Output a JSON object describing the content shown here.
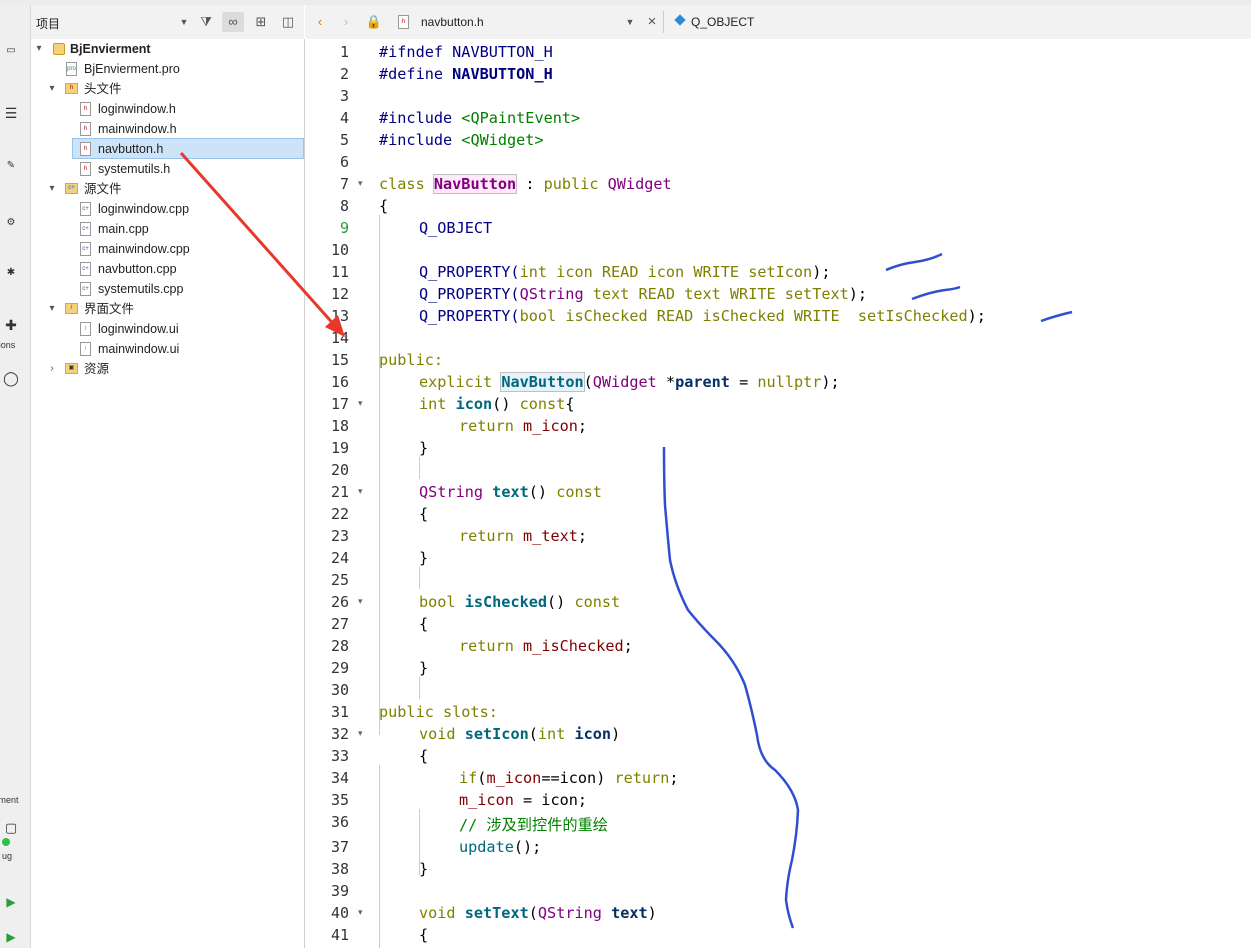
{
  "project_panel": {
    "title": "项目",
    "tree": [
      {
        "label": "BjEnvierment",
        "kind": "project"
      },
      {
        "label": "BjEnvierment.pro",
        "kind": "pro"
      },
      {
        "label": "头文件",
        "kind": "folder-h"
      },
      {
        "label": "loginwindow.h",
        "kind": "h"
      },
      {
        "label": "mainwindow.h",
        "kind": "h"
      },
      {
        "label": "navbutton.h",
        "kind": "h",
        "selected": true
      },
      {
        "label": "systemutils.h",
        "kind": "h"
      },
      {
        "label": "源文件",
        "kind": "folder-cpp"
      },
      {
        "label": "loginwindow.cpp",
        "kind": "cpp"
      },
      {
        "label": "main.cpp",
        "kind": "cpp"
      },
      {
        "label": "mainwindow.cpp",
        "kind": "cpp"
      },
      {
        "label": "navbutton.cpp",
        "kind": "cpp"
      },
      {
        "label": "systemutils.cpp",
        "kind": "cpp"
      },
      {
        "label": "界面文件",
        "kind": "folder-ui"
      },
      {
        "label": "loginwindow.ui",
        "kind": "ui"
      },
      {
        "label": "mainwindow.ui",
        "kind": "ui"
      },
      {
        "label": "资源",
        "kind": "folder-res"
      }
    ]
  },
  "modebar": {
    "kit_label": "rment",
    "debug_label": "ug",
    "extensions_label": "ions"
  },
  "editor": {
    "file_name": "navbutton.h",
    "symbol": "Q_OBJECT",
    "current_line": 9,
    "lines": [
      "1",
      "2",
      "3",
      "4",
      "5",
      "6",
      "7",
      "8",
      "9",
      "10",
      "11",
      "12",
      "13",
      "14",
      "15",
      "16",
      "17",
      "18",
      "19",
      "20",
      "21",
      "22",
      "23",
      "24",
      "25",
      "26",
      "27",
      "28",
      "29",
      "30",
      "31",
      "32",
      "33",
      "34",
      "35",
      "36",
      "37",
      "38",
      "39",
      "40",
      "41"
    ],
    "code": {
      "l1a": "#ifndef",
      "l1b": " NAVBUTTON_H",
      "l2a": "#define",
      "l2b": " NAVBUTTON_H",
      "l4a": "#include",
      "l4b": " <QPaintEvent>",
      "l5a": "#include",
      "l5b": " <QWidget>",
      "l7a": "class",
      "l7b": "NavButton",
      "l7c": " : ",
      "l7d": "public",
      "l7e": "QWidget",
      "l8": "{",
      "l9": "Q_OBJECT",
      "l11a": "Q_PROPERTY(",
      "l11b": "int",
      "l11c": " icon READ icon WRITE setIcon",
      "l11d": ");",
      "l12a": "Q_PROPERTY(",
      "l12b": "QString",
      "l12c": " text READ text WRITE setText",
      "l12d": ");",
      "l13a": "Q_PROPERTY(",
      "l13b": "bool",
      "l13c": " isChecked READ isChecked WRITE  setIsChecked",
      "l13d": ");",
      "l15": "public:",
      "l16a": "explicit",
      "l16b": "NavButton",
      "l16c": "(",
      "l16d": "QWidget",
      "l16e": " *",
      "l16f": "parent",
      "l16g": " = ",
      "l16h": "nullptr",
      "l16i": ");",
      "l17a": "int",
      "l17b": "icon",
      "l17c": "() ",
      "l17d": "const",
      "l17e": "{",
      "l18a": "return",
      "l18b": "m_icon",
      "l18c": ";",
      "l19": "}",
      "l21a": "QString",
      "l21b": "text",
      "l21c": "() ",
      "l21d": "const",
      "l22": "{",
      "l23a": "return",
      "l23b": "m_text",
      "l23c": ";",
      "l24": "}",
      "l26a": "bool",
      "l26b": "isChecked",
      "l26c": "() ",
      "l26d": "const",
      "l27": "{",
      "l28a": "return",
      "l28b": "m_isChecked",
      "l28c": ";",
      "l29": "}",
      "l31": "public slots:",
      "l32a": "void",
      "l32b": "setIcon",
      "l32c": "(",
      "l32d": "int",
      "l32e": "icon",
      "l32f": ")",
      "l33": "{",
      "l34a": "if",
      "l34b": "(",
      "l34c": "m_icon",
      "l34d": "==icon) ",
      "l34e": "return",
      "l34f": ";",
      "l35a": "m_icon",
      "l35b": " = icon;",
      "l36": "// 涉及到控件的重绘",
      "l37a": "update",
      "l37b": "();",
      "l38": "}",
      "l40a": "void",
      "l40b": "setText",
      "l40c": "(",
      "l40d": "QString",
      "l40e": "text",
      "l40f": ")",
      "l41": "{"
    }
  },
  "colors": {
    "annotation_blue": "#2f4fd0",
    "arrow_red": "#e8382c"
  }
}
